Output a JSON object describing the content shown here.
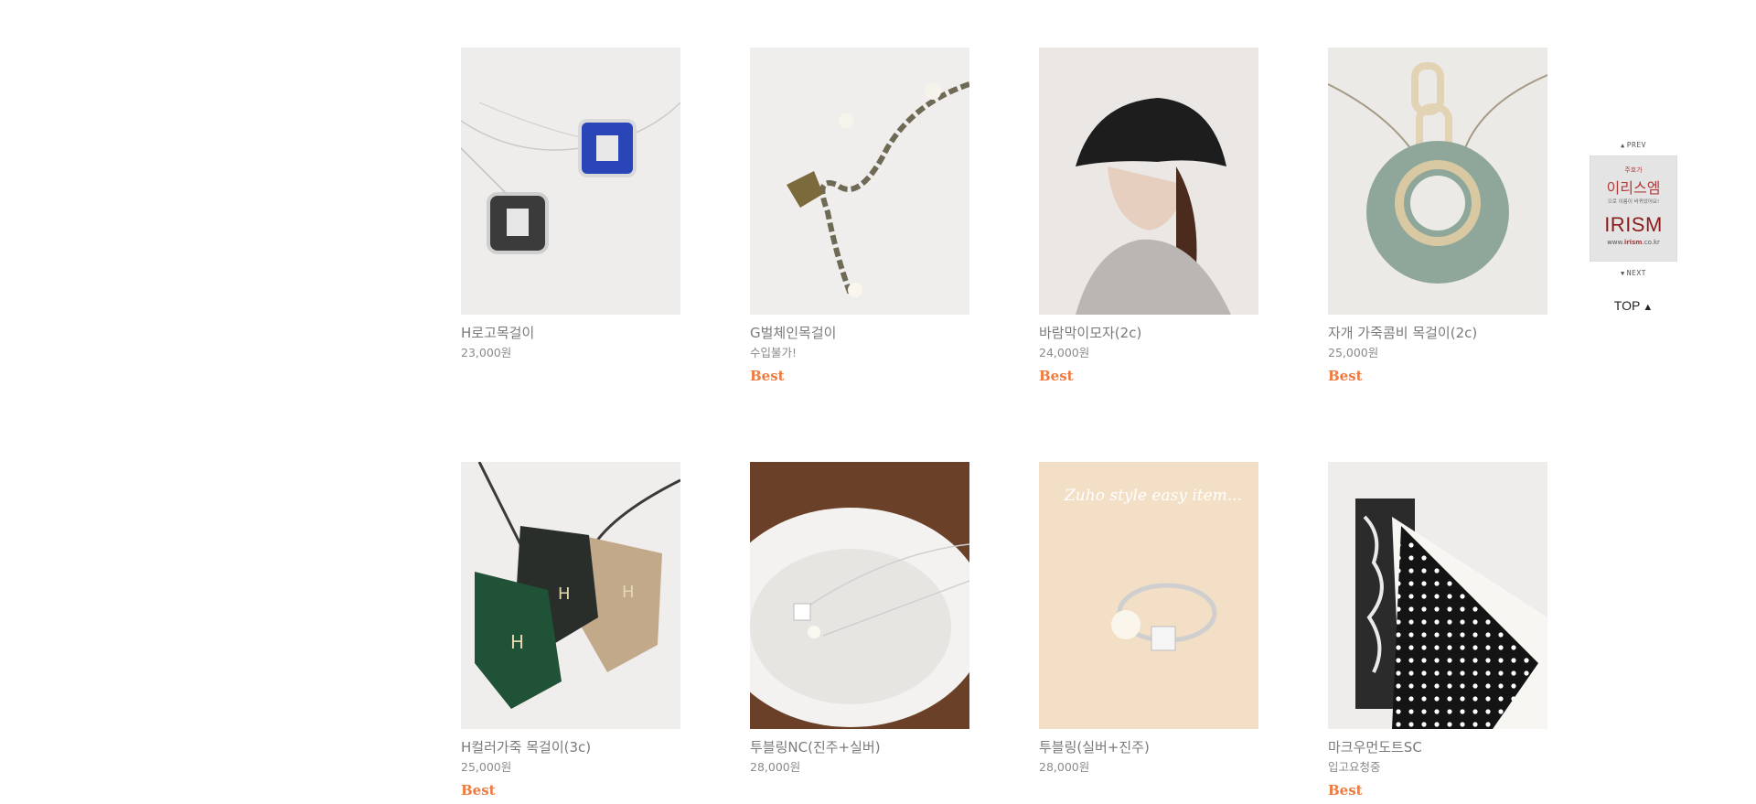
{
  "products": [
    {
      "name": "H로고목걸이",
      "price": "23,000원",
      "badge": ""
    },
    {
      "name": "G벌체인목걸이",
      "price": "수입불가!",
      "badge": "Best"
    },
    {
      "name": "바람막이모자(2c)",
      "price": "24,000원",
      "badge": "Best"
    },
    {
      "name": "자개 가죽콤비 목걸이(2c)",
      "price": "25,000원",
      "badge": "Best"
    },
    {
      "name": "H컬러가죽 목걸이(3c)",
      "price": "25,000원",
      "badge": "Best"
    },
    {
      "name": "투블링NC(진주+실버)",
      "price": "28,000원",
      "badge": ""
    },
    {
      "name": "투블링(실버+진주)",
      "price": "28,000원",
      "badge": ""
    },
    {
      "name": "마크우먼도트SC",
      "price": "입고요청중",
      "badge": "Best"
    }
  ],
  "image_caption": "Zuho style easy item...",
  "quickbar": {
    "prev_label": "PREV",
    "next_label": "NEXT",
    "top_label": "TOP",
    "top_arrow": "▲",
    "banner": {
      "line1": "주호가",
      "line2": "이리스엠",
      "line3": "으로 이름이 바뀌었어요!",
      "brand": "IRISM",
      "url_prefix": "www.",
      "url_brand": "irism",
      "url_suffix": ".co.kr"
    }
  },
  "colors": {
    "badge": "#ef7a3f",
    "text": "#7a7a7a",
    "brand": "#8c1b1b"
  }
}
